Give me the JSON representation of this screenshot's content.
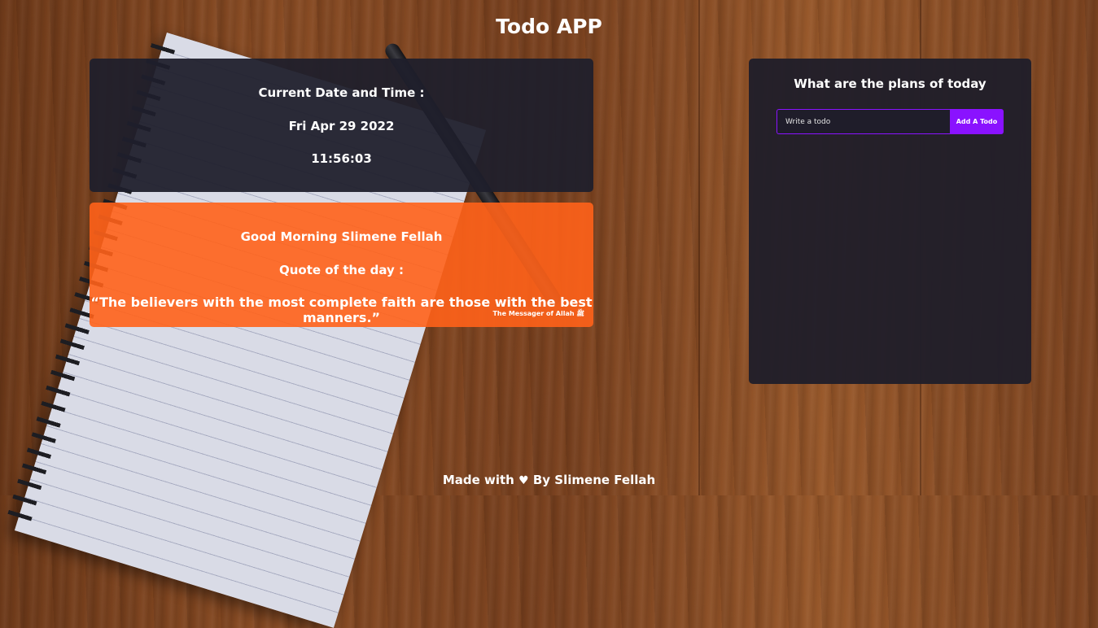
{
  "app": {
    "title": "Todo APP"
  },
  "datetime_card": {
    "label": "Current Date and Time :",
    "date": "Fri Apr 29 2022",
    "time": "11:56:03"
  },
  "quote_card": {
    "greeting": "Good Morning Slimene Fellah",
    "quote_label": "Quote of the day :",
    "quote": "“The believers with the most complete faith are those with the best manners.”",
    "attribution": "The Messager of Allah ﷺ"
  },
  "todo_card": {
    "heading": "What are the plans of today",
    "input_placeholder": "Write a todo",
    "input_value": "",
    "add_button_label": "Add A Todo",
    "accent_color": "#8a12ff"
  },
  "footer": {
    "prefix": "Made with",
    "icon": "heart-icon",
    "suffix": "By Slimene Fellah"
  },
  "colors": {
    "dark_card": "#1f1f2c",
    "quote_card": "#ff6219",
    "accent": "#8a12ff"
  }
}
